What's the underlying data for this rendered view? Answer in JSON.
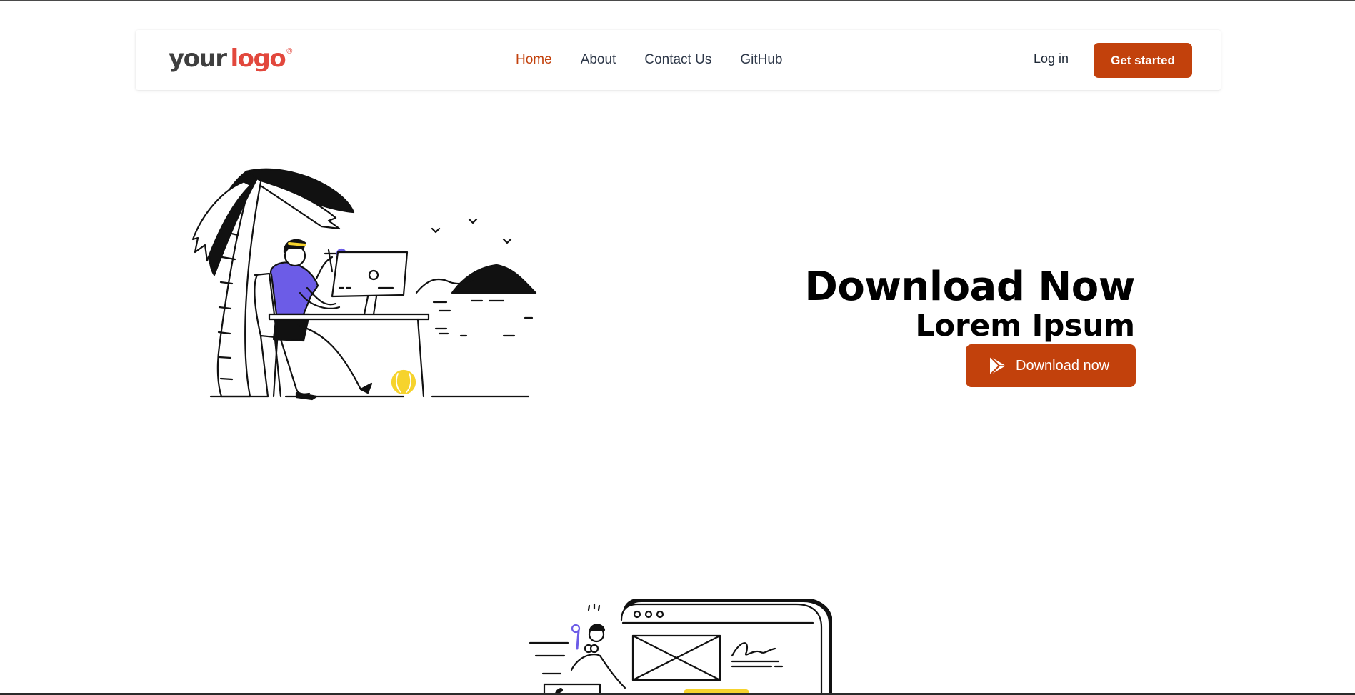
{
  "brand": {
    "logo_part1": "your",
    "logo_part2": "logo",
    "logo_mark": "®"
  },
  "nav": {
    "links": [
      {
        "label": "Home",
        "active": true
      },
      {
        "label": "About",
        "active": false
      },
      {
        "label": "Contact Us",
        "active": false
      },
      {
        "label": "GitHub",
        "active": false
      }
    ],
    "login_label": "Log in",
    "cta_label": "Get started"
  },
  "hero": {
    "title": "Download Now",
    "subtitle": "Lorem Ipsum",
    "button_label": "Download now",
    "button_icon": "play-store-icon",
    "illustration": "man-working-at-desk-under-palm-tree"
  },
  "section2": {
    "illustration": "person-with-browser-window"
  },
  "colors": {
    "accent": "#c2410c",
    "logo_red": "#e2483d",
    "purple": "#6c5ce7",
    "yellow": "#f6d32d"
  }
}
